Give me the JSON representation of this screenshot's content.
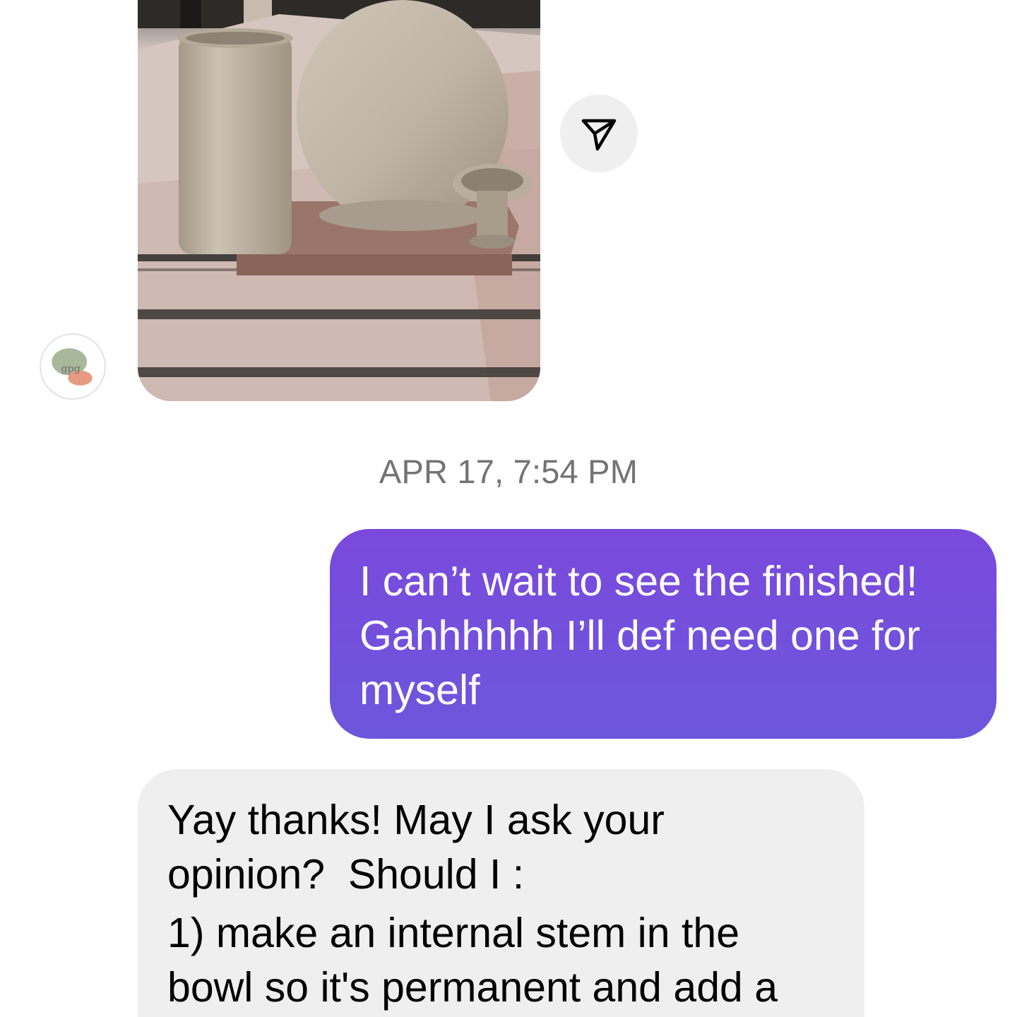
{
  "conversation": {
    "photo_message": {
      "description_icon": "photo-icon"
    },
    "avatar": {
      "initials": "gpg"
    },
    "share_button": {
      "icon": "send-icon"
    },
    "timestamp": "APR 17, 7:54 PM",
    "outgoing_message": {
      "lines": [
        "I can’t wait to see the finished!",
        "Gahhhhhh I’ll def need one for",
        "myself"
      ],
      "colors": {
        "gradient_top": "#7a49dc",
        "gradient_bottom": "#6c57dc"
      }
    },
    "incoming_message": {
      "lines": [
        "Yay thanks! May I ask your",
        "opinion?  Should I :",
        "1) make an internal stem in the",
        "bowl so it's permanent and add a"
      ],
      "colors": {
        "background": "#efefef"
      }
    }
  }
}
